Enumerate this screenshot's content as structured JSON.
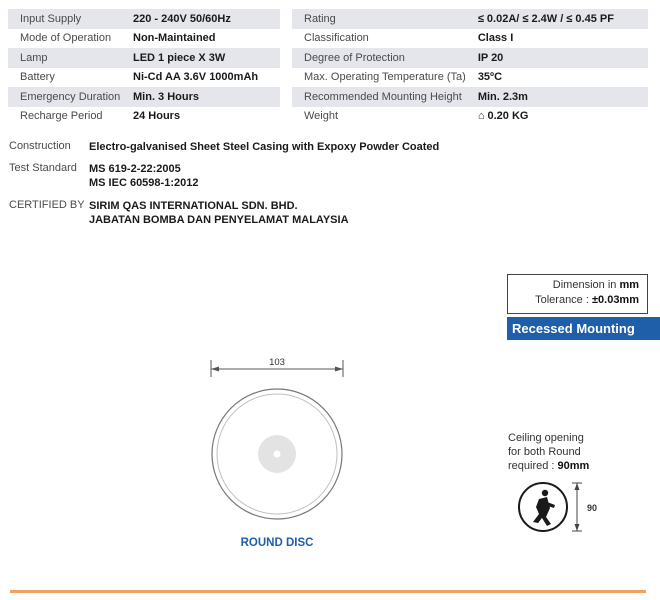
{
  "specs_left": [
    {
      "label": "Input Supply",
      "value": "220 - 240V 50/60Hz"
    },
    {
      "label": "Mode of Operation",
      "value": "Non-Maintained"
    },
    {
      "label": "Lamp",
      "value": "LED 1 piece X 3W"
    },
    {
      "label": "Battery",
      "value": "Ni-Cd AA 3.6V 1000mAh"
    },
    {
      "label": "Emergency Duration",
      "value": "Min. 3 Hours"
    },
    {
      "label": "Recharge Period",
      "value": "24 Hours"
    }
  ],
  "specs_right": [
    {
      "label": "Rating",
      "value": "≤ 0.02A/ ≤ 2.4W / ≤ 0.45 PF"
    },
    {
      "label": "Classification",
      "value": "Class I"
    },
    {
      "label": "Degree of Protection",
      "value": "IP 20"
    },
    {
      "label": "Max. Operating Temperature (Ta)",
      "value": "35ºC"
    },
    {
      "label": "Recommended Mounting Height",
      "value": "Min. 2.3m"
    },
    {
      "label": "Weight",
      "value": "⌂ 0.20 KG"
    }
  ],
  "construction": {
    "label": "Construction",
    "value": "Electro-galvanised Sheet Steel Casing with Expoxy Powder Coated"
  },
  "test_standard": {
    "label": "Test Standard",
    "values": [
      "MS 619-2-22:2005",
      "MS IEC 60598-1:2012"
    ]
  },
  "certified_by": {
    "label": "CERTIFIED BY",
    "values": [
      "SIRIM QAS INTERNATIONAL SDN. BHD.",
      "JABATAN BOMBA DAN PENYELAMAT MALAYSIA"
    ]
  },
  "dimension": {
    "prefix": "Dimension in ",
    "unit": "mm",
    "tolerance_prefix": "Tolerance : ",
    "tolerance_value": "±0.03mm"
  },
  "mounting_label": "Recessed Mounting",
  "drawing": {
    "width_value": "103",
    "caption": "ROUND DISC"
  },
  "ceiling": {
    "line1": "Ceiling opening",
    "line2": "for both Round",
    "line3_prefix": "required : ",
    "line3_value": "90mm",
    "dimension_value": "90"
  },
  "colors": {
    "accent_blue": "#1f5ea8",
    "row_shade": "#e4e6ec",
    "footer_rule": "#f0a35c"
  },
  "icons": {
    "weight": "weight-icon",
    "emergency_exit": "running-man-icon"
  }
}
